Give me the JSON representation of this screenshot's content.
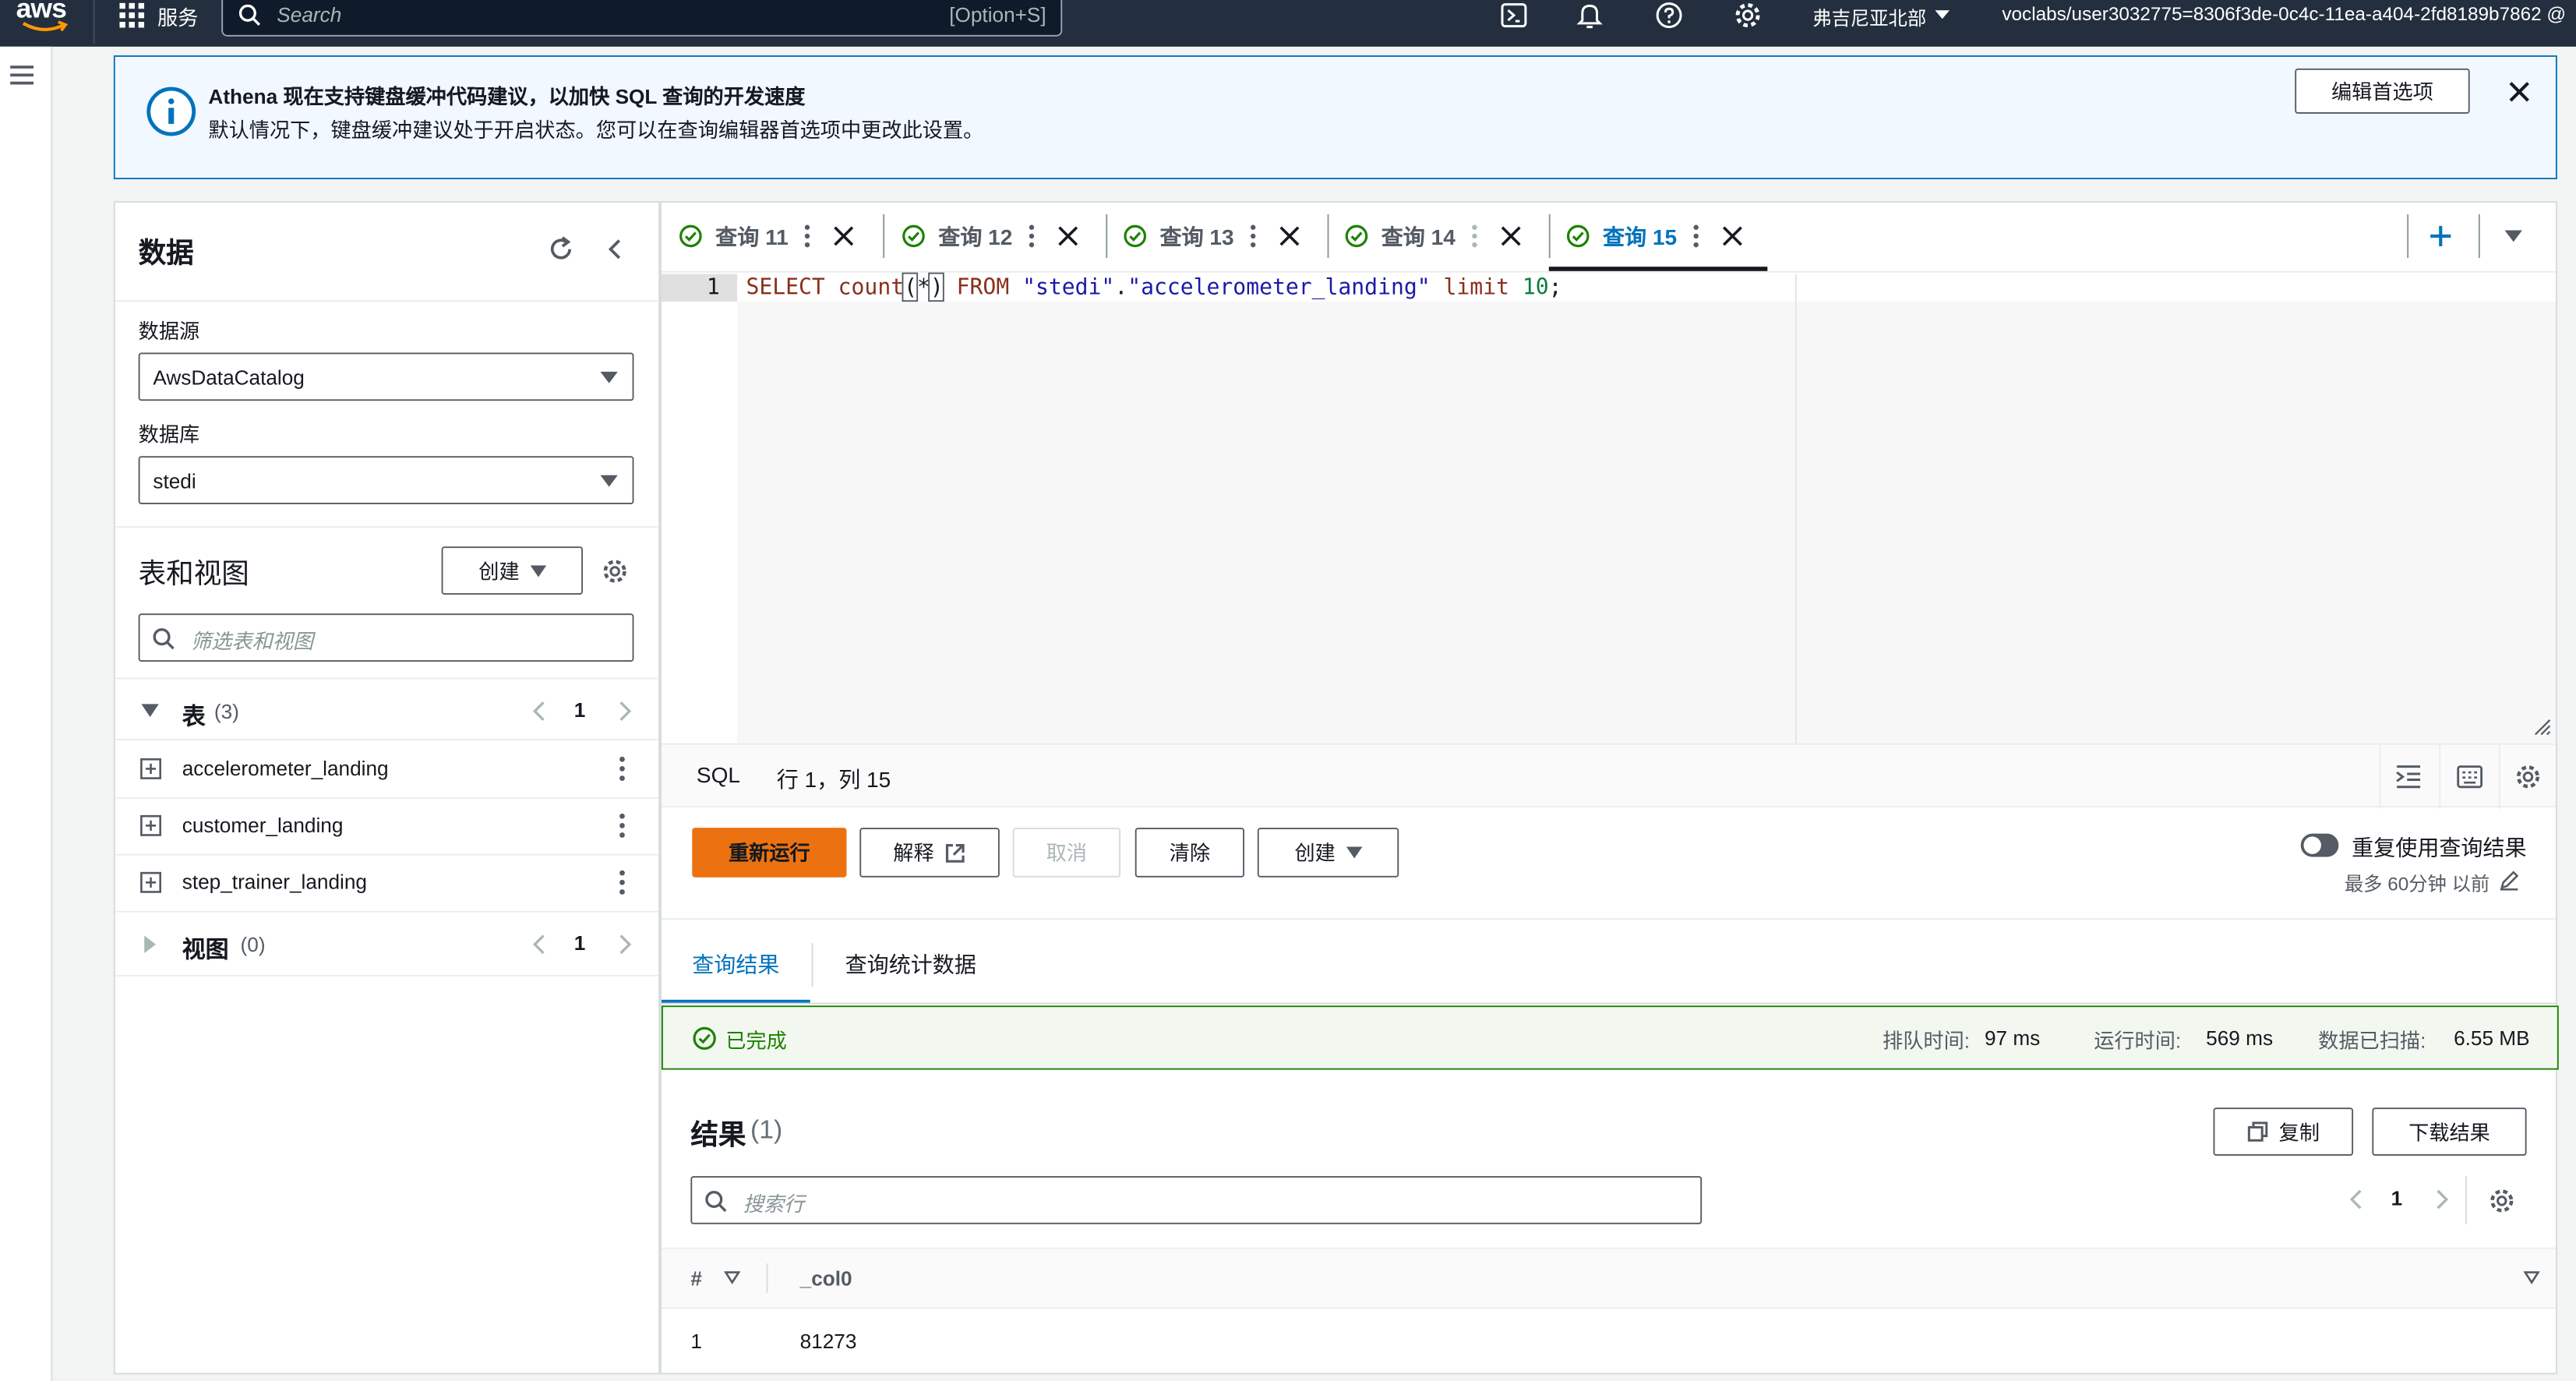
{
  "nav": {
    "logo": "aws",
    "services": "服务",
    "search_placeholder": "Search",
    "search_shortcut": "[Option+S]",
    "region": "弗吉尼亚北部",
    "account": "voclabs/user3032775=8306f3de-0c4c-11ea-a404-2fd8189b7862 @"
  },
  "banner": {
    "title": "Athena 现在支持键盘缓冲代码建议，以加快 SQL 查询的开发速度",
    "body": "默认情况下，键盘缓冲建议处于开启状态。您可以在查询编辑器首选项中更改此设置。",
    "edit_button": "编辑首选项"
  },
  "data_panel": {
    "title": "数据",
    "datasource_label": "数据源",
    "datasource_value": "AwsDataCatalog",
    "database_label": "数据库",
    "database_value": "stedi",
    "tables_views_title": "表和视图",
    "create_button": "创建",
    "filter_placeholder": "筛选表和视图",
    "tables_label": "表",
    "tables_count": "(3)",
    "tables_page": "1",
    "tables": [
      {
        "name": "accelerometer_landing"
      },
      {
        "name": "customer_landing"
      },
      {
        "name": "step_trainer_landing"
      }
    ],
    "views_label": "视图",
    "views_count": "(0)",
    "views_page": "1"
  },
  "tabs": [
    {
      "label": "查询 11"
    },
    {
      "label": "查询 12"
    },
    {
      "label": "查询 13"
    },
    {
      "label": "查询 14"
    },
    {
      "label": "查询 15",
      "active": true
    }
  ],
  "editor": {
    "line_number": "1",
    "sql": {
      "kw1": "SELECT",
      "fn": "count",
      "paren_open": "(",
      "star": "*",
      "paren_close": ")",
      "kw2": "FROM",
      "schema": "\"stedi\"",
      "dot": ".",
      "table": "\"accelerometer_landing\"",
      "kw3": "limit",
      "num": "10",
      "semi": ";"
    },
    "language": "SQL",
    "cursor_pos": "行 1，列 15"
  },
  "actions": {
    "rerun": "重新运行",
    "explain": "解释",
    "cancel": "取消",
    "clear": "清除",
    "create": "创建",
    "reuse_results": "重复使用查询结果",
    "reuse_detail": "最多 60分钟 以前"
  },
  "result_tabs": {
    "results": "查询结果",
    "stats": "查询统计数据"
  },
  "status": {
    "state": "已完成",
    "queue_label": "排队时间:",
    "queue_value": "97 ms",
    "run_label": "运行时间:",
    "run_value": "569 ms",
    "scan_label": "数据已扫描:",
    "scan_value": "6.55 MB"
  },
  "results": {
    "title": "结果",
    "count": "(1)",
    "copy_button": "复制",
    "download_button": "下载结果",
    "search_placeholder": "搜索行",
    "page": "1",
    "columns": [
      "#",
      "_col0"
    ],
    "rows": [
      [
        "1",
        "81273"
      ]
    ]
  },
  "colors": {
    "nav_bg": "#232f3e",
    "primary_orange": "#ec7211",
    "link_blue": "#0073bb",
    "success_green": "#1d8102"
  }
}
